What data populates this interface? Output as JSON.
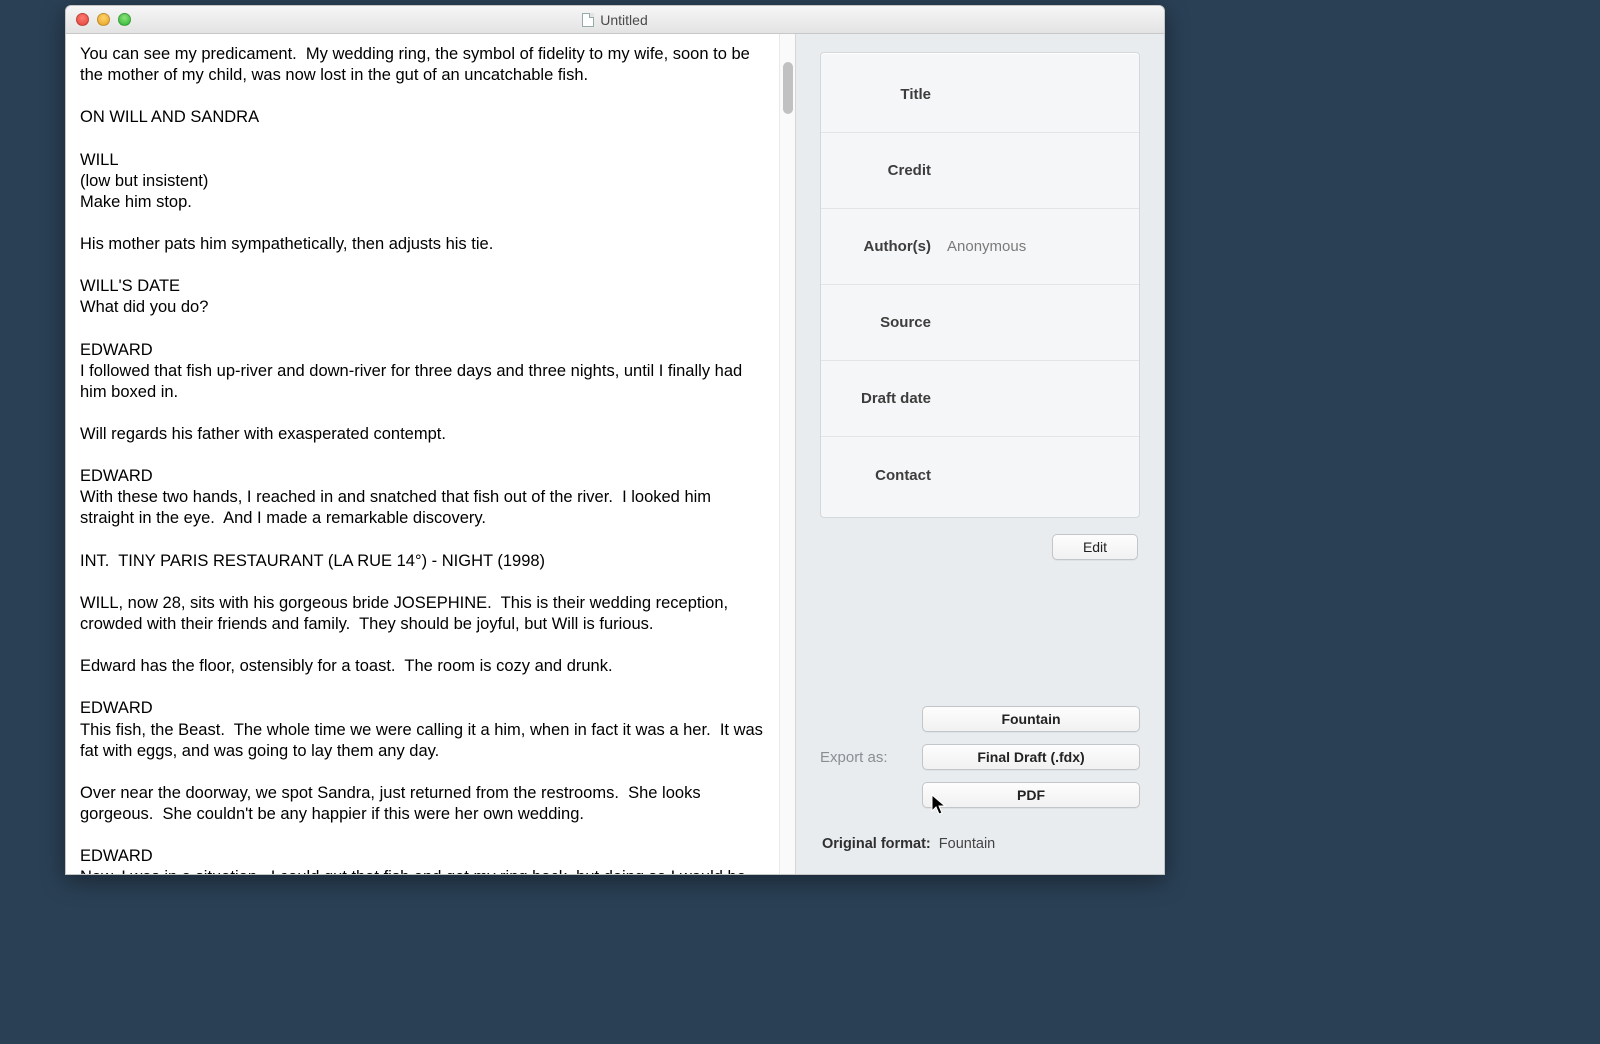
{
  "window": {
    "title": "Untitled"
  },
  "script_text": "You can see my predicament.  My wedding ring, the symbol of fidelity to my wife, soon to be the mother of my child, was now lost in the gut of an uncatchable fish.\n\nON WILL AND SANDRA\n\nWILL\n(low but insistent)\nMake him stop.\n\nHis mother pats him sympathetically, then adjusts his tie.\n\nWILL'S DATE\nWhat did you do?\n\nEDWARD\nI followed that fish up-river and down-river for three days and three nights, until I finally had him boxed in.\n\nWill regards his father with exasperated contempt.\n\nEDWARD\nWith these two hands, I reached in and snatched that fish out of the river.  I looked him straight in the eye.  And I made a remarkable discovery.\n\nINT.  TINY PARIS RESTAURANT (LA RUE 14°) - NIGHT (1998)\n\nWILL, now 28, sits with his gorgeous bride JOSEPHINE.  This is their wedding reception, crowded with their friends and family.  They should be joyful, but Will is furious.\n\nEdward has the floor, ostensibly for a toast.  The room is cozy and drunk.\n\nEDWARD\nThis fish, the Beast.  The whole time we were calling it a him, when in fact it was a her.  It was fat with eggs, and was going to lay them any day.\n\nOver near the doorway, we spot Sandra, just returned from the restrooms.  She looks gorgeous.  She couldn't be any happier if this were her own wedding.\n\nEDWARD\nNow, I was in a situation.  I could gut that fish and get my ring back, but doing so I would be killing the smartest catfish in the Ashton River, soon to be mother of a hundred others.",
  "meta": {
    "labels": {
      "title": "Title",
      "credit": "Credit",
      "authors": "Author(s)",
      "source": "Source",
      "draft_date": "Draft date",
      "contact": "Contact"
    },
    "values": {
      "title": "",
      "credit": "",
      "authors": "Anonymous",
      "source": "",
      "draft_date": "",
      "contact": ""
    },
    "edit_label": "Edit"
  },
  "export": {
    "label": "Export as:",
    "fountain": "Fountain",
    "fdx": "Final Draft (.fdx)",
    "pdf": "PDF"
  },
  "original_format": {
    "label": "Original format:",
    "value": "Fountain"
  }
}
